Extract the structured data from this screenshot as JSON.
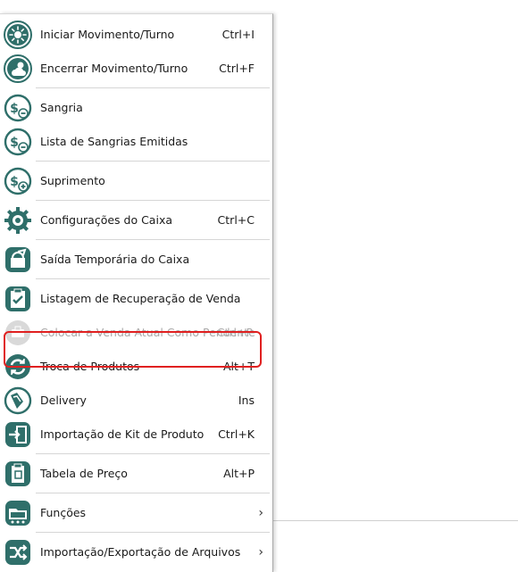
{
  "menu": {
    "items": [
      {
        "label": "Iniciar Movimento/Turno",
        "shortcut": "Ctrl+I",
        "icon": "sun-icon"
      },
      {
        "label": "Encerrar Movimento/Turno",
        "shortcut": "Ctrl+F",
        "icon": "sun-cloud-icon"
      },
      {
        "label": "Sangria",
        "shortcut": "",
        "icon": "money-minus-icon"
      },
      {
        "label": "Lista de Sangrias Emitidas",
        "shortcut": "",
        "icon": "money-minus-list-icon"
      },
      {
        "label": "Suprimento",
        "shortcut": "",
        "icon": "money-plus-icon"
      },
      {
        "label": "Configurações do Caixa",
        "shortcut": "Ctrl+C",
        "icon": "gear-icon"
      },
      {
        "label": "Saída Temporária do Caixa",
        "shortcut": "",
        "icon": "exit-temporary-icon"
      },
      {
        "label": "Listagem de Recuperação de Venda",
        "shortcut": "",
        "icon": "checklist-icon"
      },
      {
        "label": "Colocar a Venda Atual Como Pendente",
        "shortcut": "Ctrl+P",
        "icon": "pending-sale-icon",
        "disabled": true
      },
      {
        "label": "Troca de Produtos",
        "shortcut": "Alt+T",
        "icon": "exchange-icon"
      },
      {
        "label": "Delivery",
        "shortcut": "Ins",
        "icon": "delivery-icon"
      },
      {
        "label": "Importação de Kit de Produto",
        "shortcut": "Ctrl+K",
        "icon": "import-icon"
      },
      {
        "label": "Tabela de Preço",
        "shortcut": "Alt+P",
        "icon": "price-table-icon"
      },
      {
        "label": "Funções",
        "shortcut": "",
        "icon": "functions-icon",
        "submenu": true
      },
      {
        "label": "Importação/Exportação de Arquivos",
        "shortcut": "",
        "icon": "import-export-icon",
        "submenu": true
      }
    ]
  },
  "colors": {
    "icon_teal": "#2f6f6a",
    "highlight_red": "#e02020",
    "disabled_text": "#a9a9a9"
  }
}
